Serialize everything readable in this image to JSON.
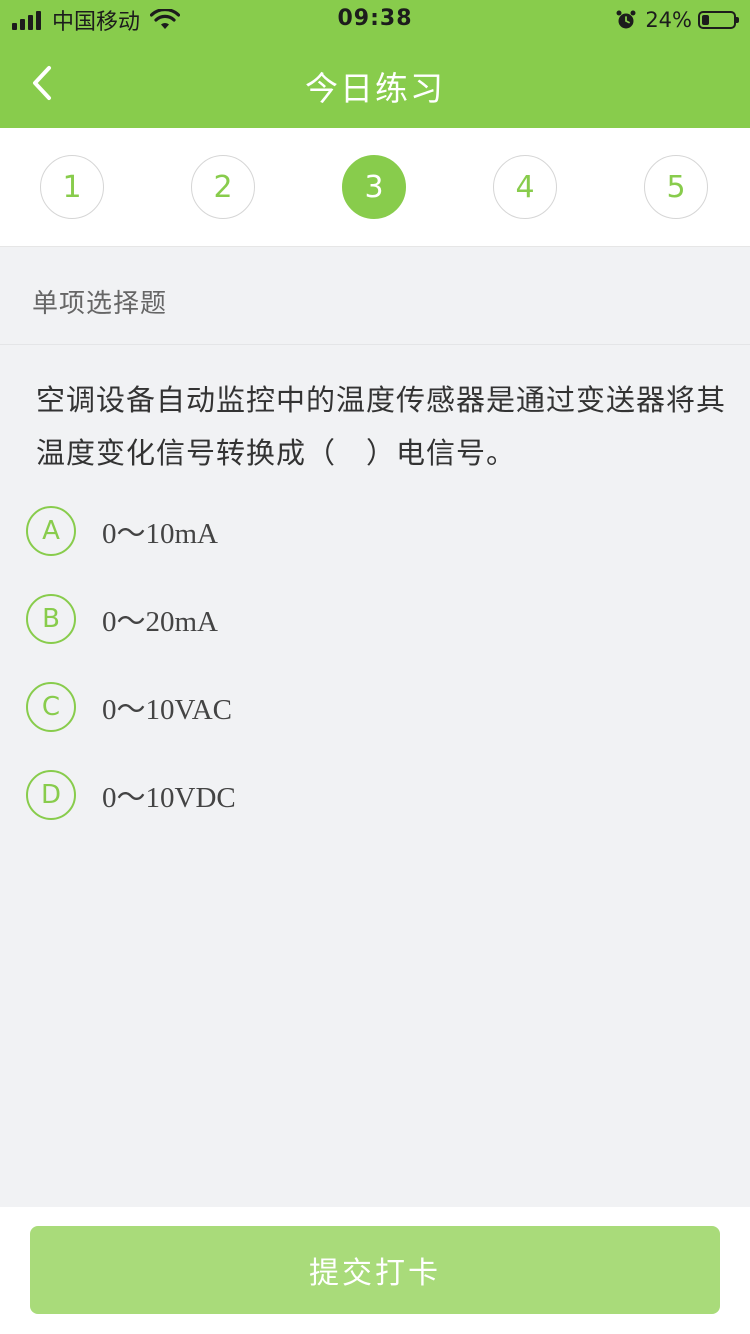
{
  "status_bar": {
    "carrier": "中国移动",
    "time": "09:38",
    "battery": "24%",
    "battery_level": 0.24,
    "icons": [
      "signal-icon",
      "wifi-icon",
      "alarm-icon",
      "battery-icon"
    ]
  },
  "nav": {
    "title": "今日练习",
    "back_icon": "chevron-left-icon"
  },
  "steps": {
    "items": [
      "1",
      "2",
      "3",
      "4",
      "5"
    ],
    "active": "3"
  },
  "question": {
    "type": "单项选择题",
    "text": "空调设备自动监控中的温度传感器是通过变送器将其温度变化信号转换成（　）电信号。",
    "options": [
      {
        "letter": "A",
        "text": "0～10mA"
      },
      {
        "letter": "B",
        "text": "0～20mA"
      },
      {
        "letter": "C",
        "text": "0～10VAC"
      },
      {
        "letter": "D",
        "text": "0～10VDC"
      }
    ]
  },
  "footer": {
    "submit_label": "提交打卡"
  },
  "colors": {
    "primary": "#88cc4c",
    "primary_light": "#a9db7a",
    "background": "#f1f2f4"
  }
}
